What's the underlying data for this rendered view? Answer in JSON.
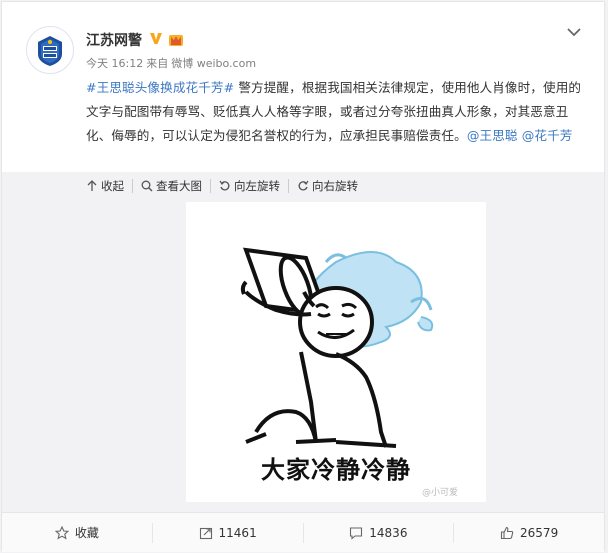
{
  "post": {
    "author": "江苏网警",
    "time": "今天 16:12",
    "source_prefix": "来自",
    "source": "微博 weibo.com",
    "content": {
      "topic": "#王思聪头像换成花千芳#",
      "body": " 警方提醒，根据我国相关法律规定，使用他人肖像时，使用的文字与配图带有辱骂、贬低真人人格等字眼，或者过分夸张扭曲真人形象，对其恶意丑化、侮辱的，可以认定为侵犯名誉权的行为，应承担民事赔偿责任。",
      "mention1": "@王思聪",
      "mention2": "@花千芳"
    }
  },
  "media_tools": {
    "collapse": "收起",
    "view_large": "查看大图",
    "rotate_left": "向左旋转",
    "rotate_right": "向右旋转"
  },
  "image": {
    "caption": "大家冷静冷静",
    "watermark": "@小可爱"
  },
  "footer": {
    "favorite": "收藏",
    "reposts": "11461",
    "comments": "14836",
    "likes": "26579"
  },
  "colors": {
    "link": "#3b78c3",
    "verified": "#f9a71a"
  }
}
